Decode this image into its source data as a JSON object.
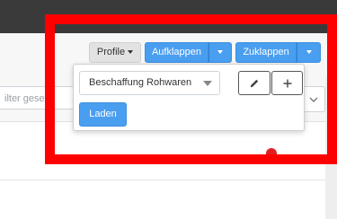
{
  "toolbar": {
    "profile_label": "Profile",
    "aufklappen_label": "Aufklappen",
    "zuklappen_label": "Zuklappen"
  },
  "filter": {
    "placeholder": "ilter gesetz"
  },
  "profile_panel": {
    "selected_profile": "Beschaffung Rohwaren",
    "load_label": "Laden"
  },
  "colors": {
    "primary": "#4a9ef0",
    "highlight": "#ff0000"
  },
  "icons": {
    "edit": "pencil-icon",
    "add": "plus-icon"
  }
}
